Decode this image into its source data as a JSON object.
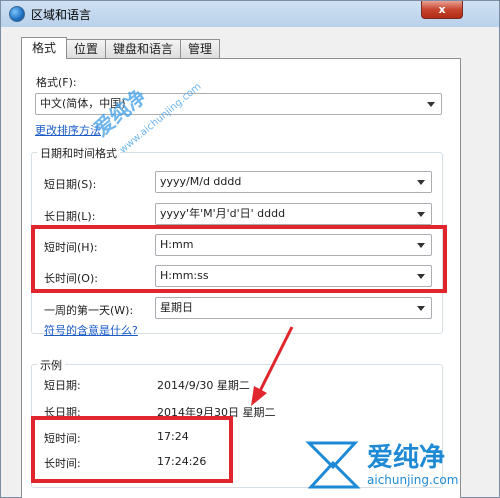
{
  "window": {
    "title": "区域和语言",
    "close_label": "x"
  },
  "tabs": [
    {
      "label": "格式",
      "active": true
    },
    {
      "label": "位置",
      "active": false
    },
    {
      "label": "键盘和语言",
      "active": false
    },
    {
      "label": "管理",
      "active": false
    }
  ],
  "format": {
    "label": "格式(F):",
    "value": "中文(简体，中国)",
    "sort_link": "更改排序方法"
  },
  "datetime_group": {
    "title": "日期和时间格式",
    "short_date": {
      "label": "短日期(S):",
      "value": "yyyy/M/d dddd"
    },
    "long_date": {
      "label": "长日期(L):",
      "value": "yyyy'年'M'月'd'日' dddd"
    },
    "short_time": {
      "label": "短时间(H):",
      "value": "H:mm"
    },
    "long_time": {
      "label": "长时间(O):",
      "value": "H:mm:ss"
    },
    "first_day": {
      "label": "一周的第一天(W):",
      "value": "星期日"
    },
    "symbols_link": "符号的含意是什么?"
  },
  "examples": {
    "title": "示例",
    "short_date": {
      "label": "短日期:",
      "value": "2014/9/30 星期二"
    },
    "long_date": {
      "label": "长日期:",
      "value": "2014年9月30日 星期二"
    },
    "short_time": {
      "label": "短时间:",
      "value": "17:24"
    },
    "long_time": {
      "label": "长时间:",
      "value": "17:24:26"
    }
  },
  "watermark": {
    "brand_cn": "爱纯净",
    "brand_url": "aichunjing.com",
    "overlay_cn": "爱纯净",
    "overlay_url": "www.aichunjing.com"
  },
  "colors": {
    "highlight_red": "#e0262c",
    "link_blue": "#1a5bc8",
    "watermark_blue": "#1e8ad6"
  }
}
